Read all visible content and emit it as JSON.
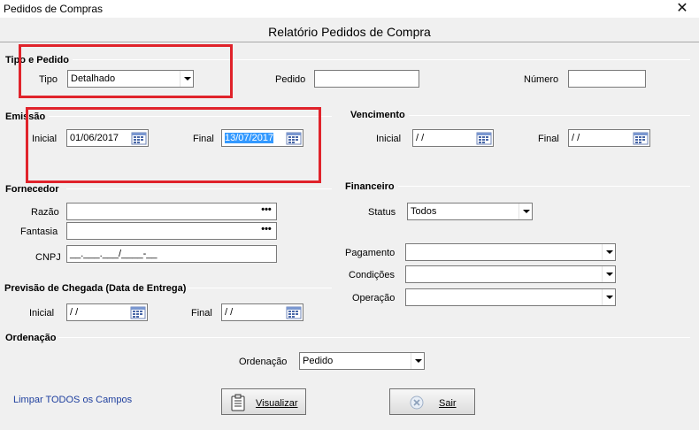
{
  "window": {
    "title": "Pedidos de Compras",
    "close_icon": "close-icon"
  },
  "header": {
    "title": "Relatório Pedidos de Compra"
  },
  "tipo_pedido": {
    "section": "Tipo e Pedido",
    "tipo_label": "Tipo",
    "tipo_value": "Detalhado",
    "pedido_label": "Pedido",
    "pedido_value": "",
    "numero_label": "Número",
    "numero_value": ""
  },
  "emissao": {
    "section": "Emissão",
    "inicial_label": "Inicial",
    "inicial_value": "01/06/2017",
    "final_label": "Final",
    "final_value": "13/07/2017"
  },
  "vencimento": {
    "section": "Vencimento",
    "inicial_label": "Inicial",
    "inicial_value": " / /",
    "final_label": "Final",
    "final_value": " / /"
  },
  "fornecedor": {
    "section": "Fornecedor",
    "razao_label": "Razão",
    "razao_value": "",
    "fantasia_label": "Fantasia",
    "fantasia_value": "",
    "cnpj_label": "CNPJ",
    "cnpj_value": "__.___.___/____-__",
    "lookup_dots": "•••"
  },
  "financeiro": {
    "section": "Financeiro",
    "status_label": "Status",
    "status_value": "Todos",
    "pagamento_label": "Pagamento",
    "pagamento_value": "",
    "condicoes_label": "Condições",
    "condicoes_value": "",
    "operacao_label": "Operação",
    "operacao_value": ""
  },
  "previsao": {
    "section": "Previsão de Chegada (Data de Entrega)",
    "inicial_label": "Inicial",
    "inicial_value": " / /",
    "final_label": "Final",
    "final_value": " / /"
  },
  "ordenacao": {
    "section": "Ordenação",
    "label": "Ordenação",
    "value": "Pedido"
  },
  "footer": {
    "clear_link": "Limpar TODOS os Campos",
    "visualizar_label": "Visualizar",
    "sair_label": "Sair"
  },
  "colors": {
    "highlight_box": "#e0232b",
    "link": "#1e3f9e",
    "selection": "#3399ff"
  }
}
